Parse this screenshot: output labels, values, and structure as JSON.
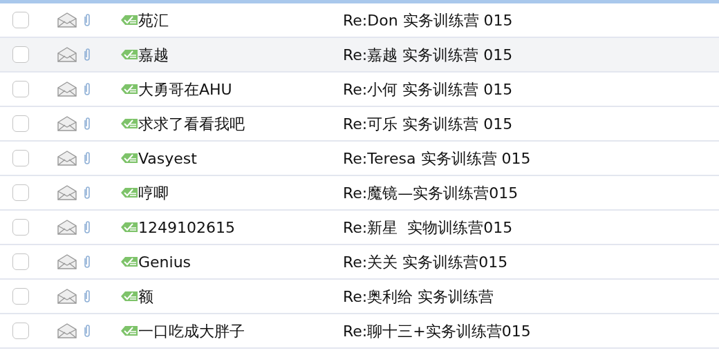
{
  "messages": [
    {
      "checked": false,
      "selected": false,
      "sender": "苑汇",
      "subject": "Re:Don 实务训练营 015"
    },
    {
      "checked": false,
      "selected": true,
      "sender": "嘉越",
      "subject": "Re:嘉越 实务训练营 015"
    },
    {
      "checked": false,
      "selected": false,
      "sender": "大勇哥在AHU",
      "subject": "Re:小何 实务训练营 015"
    },
    {
      "checked": false,
      "selected": false,
      "sender": "求求了看看我吧",
      "subject": "Re:可乐 实务训练营 015"
    },
    {
      "checked": false,
      "selected": false,
      "sender": "Vasyest",
      "subject": "Re:Teresa 实务训练营 015"
    },
    {
      "checked": false,
      "selected": false,
      "sender": "哼唧",
      "subject": "Re:魔镜—实务训练营015"
    },
    {
      "checked": false,
      "selected": false,
      "sender": "1249102615",
      "subject": "Re:新星  实物训练营015"
    },
    {
      "checked": false,
      "selected": false,
      "sender": "Genius",
      "subject": "Re:关关 实务训练营015"
    },
    {
      "checked": false,
      "selected": false,
      "sender": "额",
      "subject": "Re:奥利给 实务训练营"
    },
    {
      "checked": false,
      "selected": false,
      "sender": "一口吃成大胖子",
      "subject": "Re:聊十三+实务训练营015"
    }
  ]
}
